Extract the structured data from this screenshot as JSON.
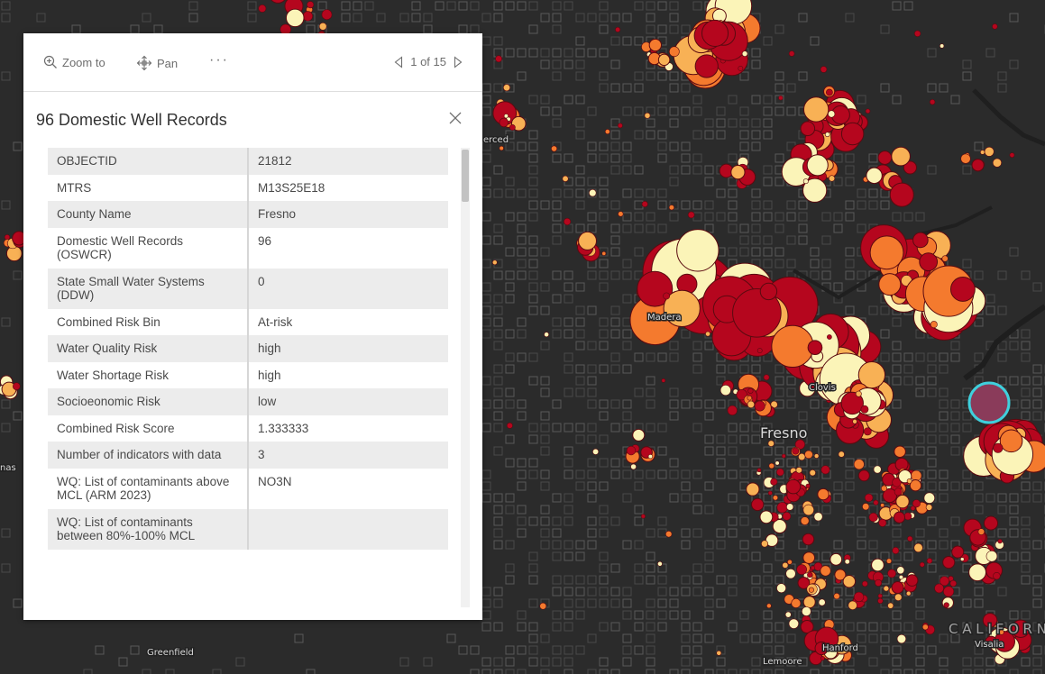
{
  "popup": {
    "zoom_label": "Zoom to",
    "pan_label": "Pan",
    "more_label": "···",
    "pager_label": "1 of 15",
    "title": "96 Domestic Well Records",
    "fields": [
      {
        "key": "OBJECTID",
        "value": "21812"
      },
      {
        "key": "MTRS",
        "value": "M13S25E18"
      },
      {
        "key": "County Name",
        "value": "Fresno"
      },
      {
        "key": "Domestic Well Records (OSWCR)",
        "value": "96"
      },
      {
        "key": "State Small Water Systems (DDW)",
        "value": "0"
      },
      {
        "key": "Combined Risk Bin",
        "value": "At-risk"
      },
      {
        "key": "Water Quality Risk",
        "value": "high"
      },
      {
        "key": "Water Shortage Risk",
        "value": "high"
      },
      {
        "key": "Socioeonomic Risk",
        "value": "low"
      },
      {
        "key": "Combined Risk Score",
        "value": "1.333333"
      },
      {
        "key": "Number of indicators with data",
        "value": "3"
      },
      {
        "key": "WQ: List of contaminants above MCL (ARM 2023)",
        "value": "NO3N"
      },
      {
        "key": "WQ: List of contaminants between 80%-100% MCL",
        "value": ""
      }
    ]
  },
  "map": {
    "places": {
      "fresno": "Fresno",
      "madera": "Madera",
      "clovis": "Clovis",
      "merced": "erced",
      "hanford": "Hanford",
      "lemoore": "Lemoore",
      "visalia": "Visalia",
      "greenfield": "Greenfield",
      "california": "C A L I F O R N",
      "left_edge": "nas"
    },
    "colors": {
      "background": "#2b2b2b",
      "grid": "#4d4d4d",
      "risk_dark_red": "#b5061e",
      "risk_orange": "#f47a2e",
      "risk_light_orange": "#f8b155",
      "risk_pale": "#fbf4b8",
      "selection": "#3fd0dd"
    }
  }
}
